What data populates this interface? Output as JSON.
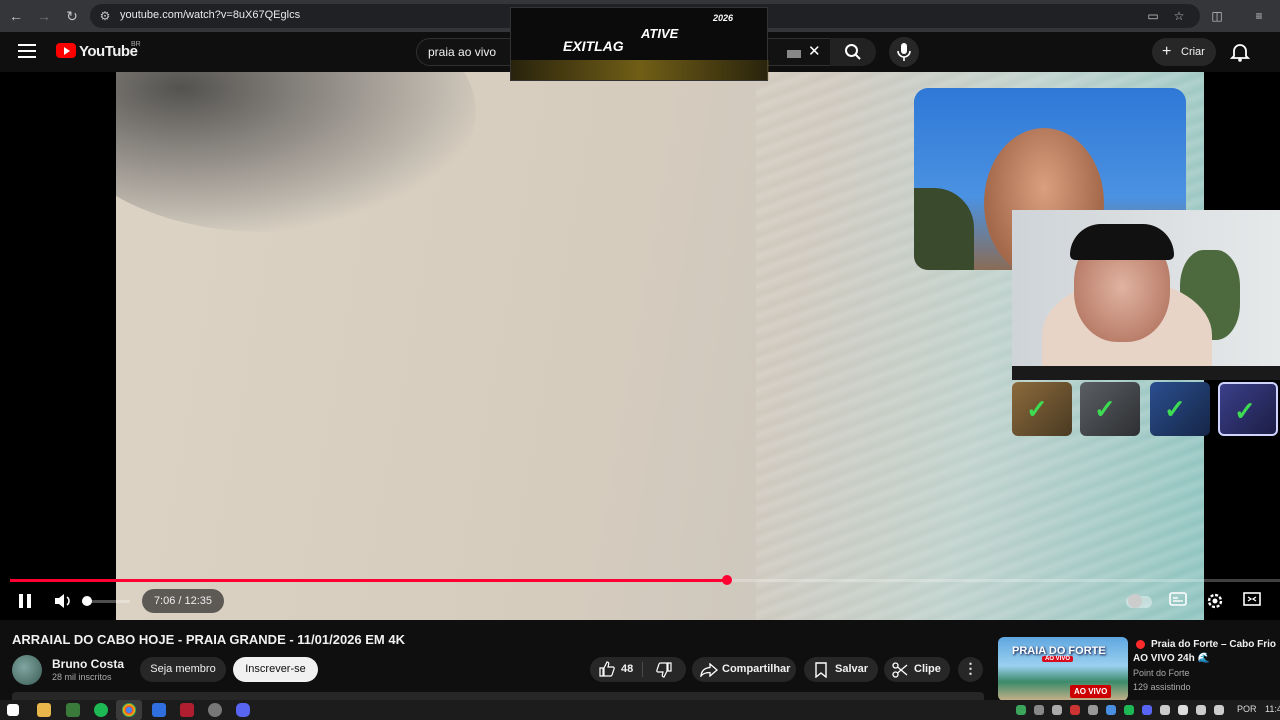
{
  "browser": {
    "url": "youtube.com/watch?v=8uX67QEglcs"
  },
  "header": {
    "logo_text": "YouTube",
    "region": "BR",
    "search_value": "praia ao vivo",
    "create_label": "Criar"
  },
  "overlay_ad": {
    "brand": "EXITLAG",
    "slogan": "ATIVE",
    "year": "2026"
  },
  "player": {
    "time_display": "7:06 / 12:35",
    "progress_fraction": 0.5643,
    "volume_fraction": 0.1,
    "colors": {
      "progress": "#ff0033",
      "background": "#0f0f0f"
    }
  },
  "video": {
    "title": "ARRAIAL DO CABO HOJE - PRAIA GRANDE - 11/01/2026 EM 4K",
    "channel_name": "Bruno Costa",
    "subscribers": "28 mil inscritos",
    "join_label": "Seja membro",
    "subscribe_label": "Inscrever-se",
    "likes": "48",
    "share_label": "Compartilhar",
    "save_label": "Salvar",
    "clip_label": "Clipe",
    "more_label": "⋮"
  },
  "related": {
    "thumb_title": "PRAIA DO FORTE",
    "thumb_subtitle": "AO VIVO",
    "live_badge": "AO VIVO",
    "title": "Praia do Forte – Cabo Frio AO VIVO 24h 🌊",
    "channel": "Point do Forte",
    "viewers": "129 assistindo"
  },
  "taskbar": {
    "language": "POR",
    "clock": "11:4"
  }
}
